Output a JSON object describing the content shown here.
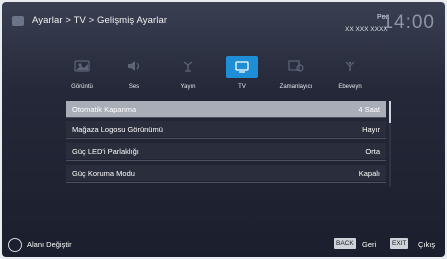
{
  "header": {
    "breadcrumb": "Ayarlar > TV > Gelişmiş Ayarlar",
    "day": "Per",
    "date": "XX XXX XXXX",
    "time": "14:00"
  },
  "tabs": [
    {
      "label": "Görüntü",
      "icon": "picture-icon",
      "active": false
    },
    {
      "label": "Ses",
      "icon": "speaker-icon",
      "active": false
    },
    {
      "label": "Yayın",
      "icon": "antenna-icon",
      "active": false
    },
    {
      "label": "TV",
      "icon": "tv-icon",
      "active": true
    },
    {
      "label": "Zamanlayıcı",
      "icon": "timer-icon",
      "active": false
    },
    {
      "label": "Ebeveyn",
      "icon": "parental-icon",
      "active": false
    }
  ],
  "menu": {
    "items": [
      {
        "label": "Otomatik Kapanma",
        "value": "4 Saat",
        "selected": true
      },
      {
        "label": "Mağaza Logosu Görünümü",
        "value": "Hayır",
        "selected": false
      },
      {
        "label": "Güç LED'i Parlaklığı",
        "value": "Orta",
        "selected": false
      },
      {
        "label": "Güç Koruma Modu",
        "value": "Kapalı",
        "selected": false
      }
    ]
  },
  "footer": {
    "nav_label": "Alanı Değiştir",
    "back_key": "BACK",
    "back_label": "Geri",
    "exit_key": "EXIT",
    "exit_label": "Çıkış"
  },
  "colors": {
    "accent": "#1e8fd6",
    "selected_row": "#a9adb8",
    "row_bg": "#2a2e3c"
  }
}
